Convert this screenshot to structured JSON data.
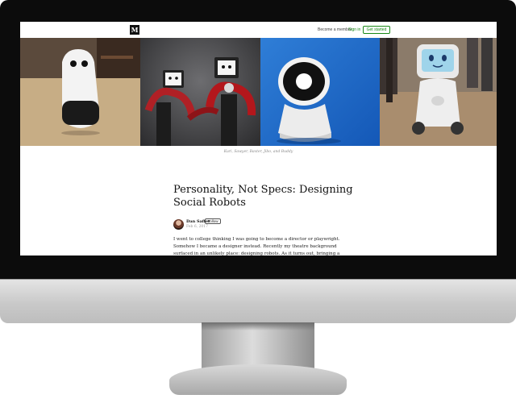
{
  "header": {
    "logo": "M",
    "member_link": "Become a member",
    "signin_link": "Sign in",
    "get_started": "Get started"
  },
  "hero": {
    "caption": "Kuri, Sawyer, Baxter, Jibo, and Buddy",
    "panels": [
      "kuri",
      "sawyer-baxter",
      "jibo",
      "buddy"
    ]
  },
  "article": {
    "title": "Personality, Not Specs: Designing Social Robots",
    "author": "Dan Saffer",
    "follow": "Follow",
    "date": "Feb 6, 2017",
    "body": "I went to college thinking I was going to become a director or playwright. Somehow I became a designer instead. Recently my theatre background surfaced in an unlikely place: designing robots. As it turns out, bringing a character to life on stage, on"
  },
  "colors": {
    "accent": "#1a8917",
    "bezel": "#0c0c0c",
    "chin": "#c9c9c9"
  }
}
